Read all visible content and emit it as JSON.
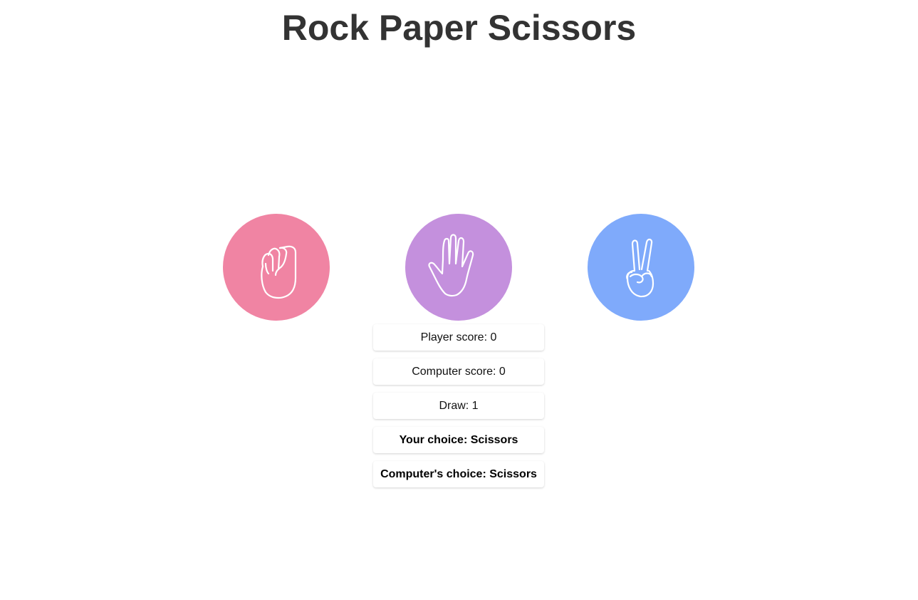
{
  "title": "Rock Paper Scissors",
  "choices": [
    {
      "name": "Rock",
      "icon": "fist-icon",
      "color": "#F084A3"
    },
    {
      "name": "Paper",
      "icon": "open-hand-icon",
      "color": "#C490DD"
    },
    {
      "name": "Scissors",
      "icon": "peace-hand-icon",
      "color": "#7FAAFB"
    }
  ],
  "scores": {
    "player": "Player score: 0",
    "computer": "Computer score: 0",
    "draw": "Draw: 1"
  },
  "result": {
    "your_choice": "Your choice: Scissors",
    "computer_choice": "Computer's choice: Scissors"
  },
  "colors": {
    "title": "#333333",
    "rock": "#F084A3",
    "paper": "#C490DD",
    "scissors": "#7FAAFB"
  }
}
